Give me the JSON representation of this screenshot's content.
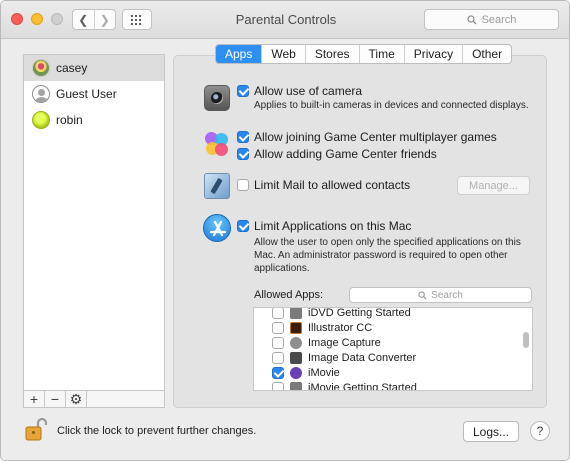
{
  "window": {
    "title": "Parental Controls",
    "search_placeholder": "Search"
  },
  "users": [
    {
      "name": "casey",
      "selected": true
    },
    {
      "name": "Guest User",
      "selected": false
    },
    {
      "name": "robin",
      "selected": false
    }
  ],
  "sidebar_buttons": {
    "add": "+",
    "remove": "−",
    "settings": "⚙"
  },
  "tabs": [
    {
      "label": "Apps",
      "active": true
    },
    {
      "label": "Web",
      "active": false
    },
    {
      "label": "Stores",
      "active": false
    },
    {
      "label": "Time",
      "active": false
    },
    {
      "label": "Privacy",
      "active": false
    },
    {
      "label": "Other",
      "active": false
    }
  ],
  "settings": {
    "camera": {
      "label": "Allow use of camera",
      "checked": true,
      "description": "Applies to built-in cameras in devices and connected displays."
    },
    "gc_multiplayer": {
      "label": "Allow joining Game Center multiplayer games",
      "checked": true
    },
    "gc_friends": {
      "label": "Allow adding Game Center friends",
      "checked": true
    },
    "mail": {
      "label": "Limit Mail to allowed contacts",
      "checked": false,
      "button": "Manage..."
    },
    "limit_apps": {
      "label": "Limit Applications on this Mac",
      "checked": true,
      "description": "Allow the user to open only the specified applications on this Mac. An administrator password is required to open other applications."
    }
  },
  "allowed_apps": {
    "label": "Allowed Apps:",
    "search_placeholder": "Search",
    "items": [
      {
        "name": "iDVD Getting Started",
        "checked": false,
        "icon_color": "#7b7b7b"
      },
      {
        "name": "Illustrator CC",
        "checked": false,
        "icon_color": "#3b1e0a"
      },
      {
        "name": "Image Capture",
        "checked": false,
        "icon_color": "#8e8e8e"
      },
      {
        "name": "Image Data Converter",
        "checked": false,
        "icon_color": "#4a4a4a"
      },
      {
        "name": "iMovie",
        "checked": true,
        "icon_color": "#6a3fb5"
      },
      {
        "name": "iMovie Getting Started",
        "checked": false,
        "icon_color": "#7b7b7b"
      }
    ]
  },
  "footer": {
    "lock_text": "Click the lock to prevent further changes.",
    "logs_button": "Logs...",
    "help_button": "?"
  },
  "colors": {
    "accent": "#2e8ff2",
    "checkbox_on": "#2b86ec"
  }
}
